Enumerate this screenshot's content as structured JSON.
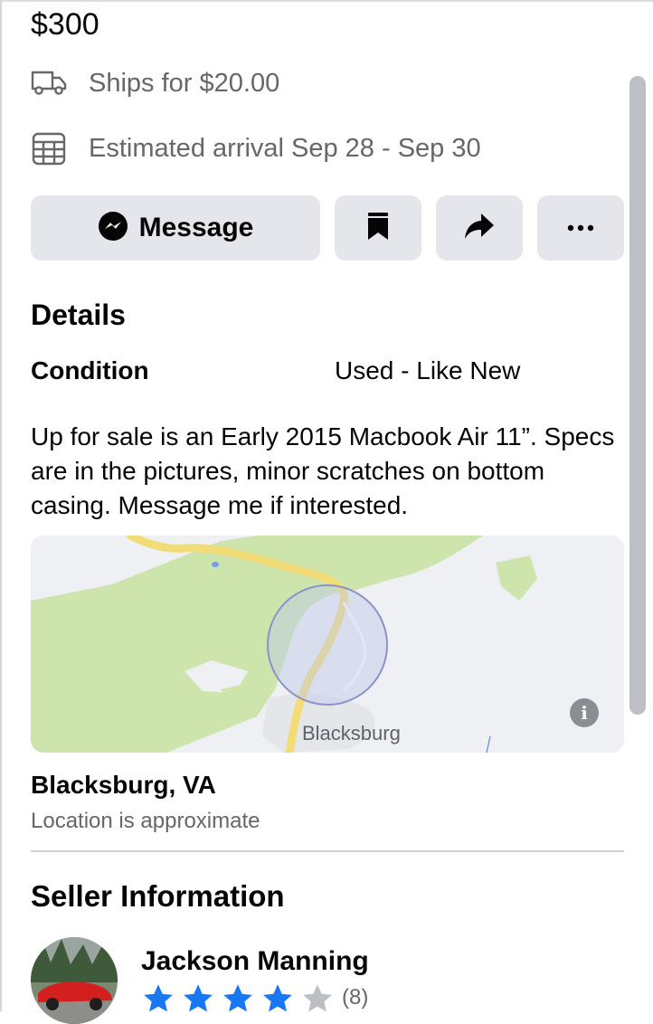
{
  "listing": {
    "price": "$300",
    "shipping": "Ships for $20.00",
    "arrival": "Estimated arrival Sep 28 - Sep 30"
  },
  "actions": {
    "message_label": "Message"
  },
  "details": {
    "heading": "Details",
    "condition_label": "Condition",
    "condition_value": "Used - Like New",
    "description": "Up for sale is an Early 2015 Macbook Air 11”. Specs are in the pictures, minor scratches on bottom casing. Message me if interested."
  },
  "map": {
    "place_label": "Blacksburg",
    "info_glyph": "i"
  },
  "location": {
    "name": "Blacksburg, VA",
    "note": "Location is approximate"
  },
  "seller": {
    "heading": "Seller Information",
    "name": "Jackson Manning",
    "rating": 4,
    "rating_max": 5,
    "rating_count": "(8)"
  },
  "icons": {
    "shipping": "truck-icon",
    "arrival": "calendar-icon",
    "message": "messenger-icon",
    "save": "bookmark-icon",
    "share": "share-icon",
    "more": "more-icon"
  },
  "colors": {
    "button_bg": "#e4e6eb",
    "secondary_text": "#65676b",
    "star_filled": "#1877f2",
    "star_empty": "#bcc0c4"
  }
}
